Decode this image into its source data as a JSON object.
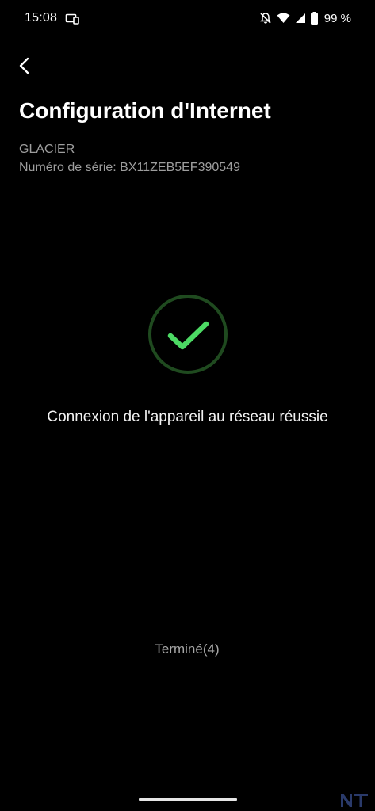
{
  "status_bar": {
    "time": "15:08",
    "battery": "99 %",
    "icons": [
      "cast-icon",
      "bell-off-icon",
      "wifi-icon",
      "signal-icon",
      "battery-icon"
    ]
  },
  "header": {
    "back_icon": "chevron-left-icon",
    "title": "Configuration d'Internet"
  },
  "device": {
    "name": "GLACIER",
    "serial": "Numéro de série: BX11ZEB5EF390549"
  },
  "result": {
    "icon": "check-circle-icon",
    "message": "Connexion de l'appareil au réseau réussie"
  },
  "actions": {
    "done_label": "Terminé(4)"
  },
  "watermark": {
    "logo": "nt-logo"
  },
  "colors": {
    "background": "#000000",
    "check_green": "#4cd964",
    "circle_ring": "#1f4a1f",
    "secondary_text": "#9e9e9e"
  }
}
